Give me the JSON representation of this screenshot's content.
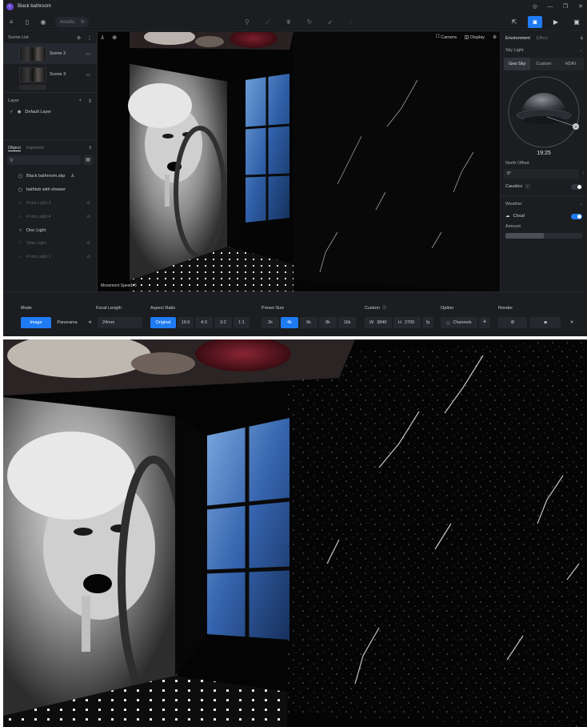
{
  "window": {
    "title": "Black bathroom",
    "logo": "app-logo-icon"
  },
  "toolbar": {
    "assets_label": "Assets"
  },
  "scene_list": {
    "title": "Scene List",
    "scenes": [
      {
        "name": "Scene 2"
      },
      {
        "name": "Scene 3"
      }
    ]
  },
  "layer": {
    "title": "Layer",
    "default_layer": "Default Layer"
  },
  "object": {
    "tab_object": "Object",
    "tab_imported": "Imported",
    "items": [
      {
        "name": "Black bathroom.skp",
        "dim": false
      },
      {
        "name": "bathtub with shower",
        "dim": false
      },
      {
        "name": "Point Light 3",
        "dim": true
      },
      {
        "name": "Point Light 4",
        "dim": true
      },
      {
        "name": "Disc Light",
        "dim": false
      },
      {
        "name": "Strip Light",
        "dim": true
      },
      {
        "name": "Point Light 1",
        "dim": true
      }
    ]
  },
  "viewport": {
    "camera_label": "Camera",
    "display_label": "Display",
    "movement_speed": "Movement Speed: 5"
  },
  "right_panel": {
    "tab_environment": "Environment",
    "tab_effect": "Effect",
    "sky_light_title": "Sky Light",
    "sky_modes": [
      "Geo Sky",
      "Custom",
      "HDRI"
    ],
    "time": "19:25",
    "north_offset_label": "North Offset",
    "north_offset_value": "0°",
    "caustics_label": "Caustics",
    "caustics_on": false,
    "weather_title": "Weather",
    "cloud_label": "Cloud",
    "cloud_on": true,
    "amount_label": "Amount",
    "amount_fraction": 0.5
  },
  "bottom": {
    "mode_label": "Mode",
    "mode_image": "Image",
    "mode_panorama": "Panorama",
    "focal_label": "Focal Length",
    "focal_value": "24mm",
    "aspect_label": "Aspect Ratio",
    "aspect_options": [
      "Original",
      "16:9",
      "4:3",
      "3:2",
      "1:1"
    ],
    "preset_label": "Preset Size",
    "preset_options": [
      "2k",
      "4k",
      "6k",
      "8k",
      "16k"
    ],
    "custom_label": "Custom",
    "custom_w_label": "W",
    "custom_w": "3840",
    "custom_h_label": "H",
    "custom_h": "2700",
    "option_label": "Option",
    "channels_label": "Channels",
    "render_label": "Render"
  },
  "colors": {
    "accent": "#1f7bf2",
    "panel": "#1b1d21",
    "background": "#16181c"
  }
}
